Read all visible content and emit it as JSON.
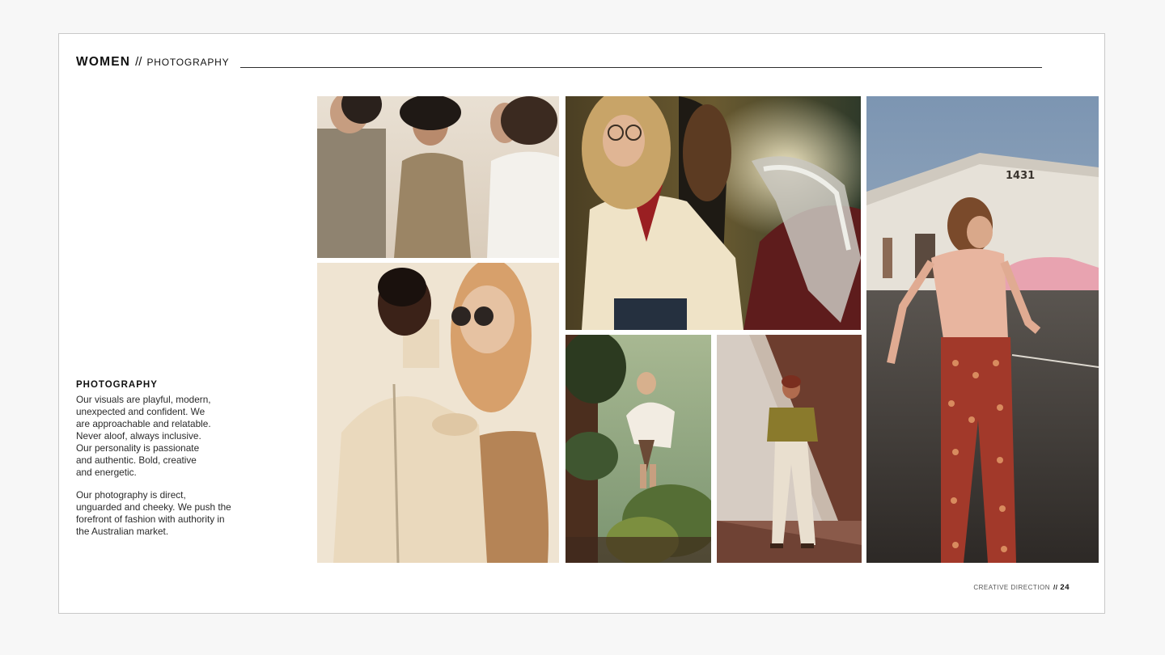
{
  "header": {
    "title": "WOMEN",
    "separator": "//",
    "subtitle": "PHOTOGRAPHY"
  },
  "text": {
    "heading": "PHOTOGRAPHY",
    "paragraph1": "Our visuals are playful, modern,\nunexpected and confident. We\nare approachable and relatable.\nNever aloof, always inclusive.\nOur personality is passionate\nand authentic. Bold, creative\nand energetic.",
    "paragraph2": "Our photography is direct,\nunguarded and cheeky. We push the\nforefront of fashion with authority in\nthe Australian market."
  },
  "footer": {
    "label": "CREATIVE DIRECTION",
    "separator": "//",
    "page_number": "24"
  },
  "photos": {
    "building_sign": "1431"
  },
  "colors": {
    "page_bg": "#ffffff",
    "canvas_bg": "#f7f7f7",
    "text": "#1a1a1a",
    "rule": "#2d2d2d"
  }
}
